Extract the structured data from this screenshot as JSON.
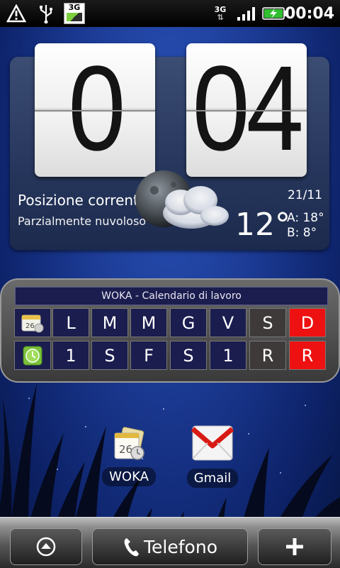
{
  "status_bar": {
    "time": "00:04",
    "left_icons": [
      "warning-icon",
      "usb-icon",
      "3g-app-icon"
    ],
    "right_icons": [
      "3g-data-icon",
      "signal-icon",
      "battery-charging-icon"
    ],
    "network_label": "3G"
  },
  "clock": {
    "hour": "0",
    "minute": "04"
  },
  "weather": {
    "location": "Posizione corrente",
    "condition": "Parzialmente nuvoloso",
    "date": "21/11",
    "temperature": "12°",
    "high": "A: 18°",
    "low": "B:  8°",
    "icon": "partly-cloudy-moon-icon"
  },
  "calendar_widget": {
    "title": "WOKA - Calendario di lavoro",
    "days": [
      "L",
      "M",
      "M",
      "G",
      "V",
      "S",
      "D"
    ],
    "shifts": [
      "1",
      "S",
      "F",
      "S",
      "1",
      "R",
      "R"
    ],
    "row_icons": [
      "calendar-icon",
      "clock-icon"
    ],
    "colors": {
      "weekday": "#1b1d4f",
      "saturday": "#3f3a3a",
      "sunday": "#ee1111"
    }
  },
  "shortcuts": [
    {
      "label": "WOKA",
      "icon": "woka-calendar-icon"
    },
    {
      "label": "Gmail",
      "icon": "gmail-icon"
    }
  ],
  "dock": {
    "phone_label": "Telefono",
    "left_icon": "apps-up-arrow-icon",
    "right_icon": "plus-icon"
  }
}
